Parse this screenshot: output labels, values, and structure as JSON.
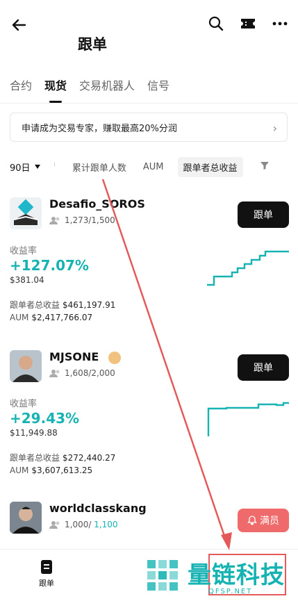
{
  "header": {
    "title": "跟单"
  },
  "tabs": [
    {
      "label": "合约"
    },
    {
      "label": "现货"
    },
    {
      "label": "交易机器人"
    },
    {
      "label": "信号"
    }
  ],
  "banner": {
    "text": "申请成为交易专家，赚取最高20%分润"
  },
  "filters": {
    "period": "90日",
    "followers": "累计跟单人数",
    "aum": "AUM",
    "active": "跟单者总收益"
  },
  "traders": [
    {
      "name": "Desafio_SOROS",
      "followers_current": "1,273",
      "followers_max": "/1,500",
      "button": "跟单",
      "roi_label": "收益率",
      "roi": "+127.07%",
      "pnl": "$381.04",
      "total_label": "跟单者总收益",
      "total": "$461,197.91",
      "aum_label": "AUM",
      "aum": "$2,417,766.07"
    },
    {
      "name": "MJSONE",
      "followers_current": "1,608",
      "followers_max": "/2,000",
      "button": "跟单",
      "roi_label": "收益率",
      "roi": "+29.43%",
      "pnl": "$11,949.88",
      "total_label": "跟单者总收益",
      "total": "$272,440.27",
      "aum_label": "AUM",
      "aum": "$3,607,613.25"
    },
    {
      "name": "worldclasskang",
      "followers_current": "1,000",
      "followers_sep": "/ ",
      "followers_max": "1,100",
      "button": "满员"
    }
  ],
  "bottom_nav": [
    {
      "label": "跟单"
    }
  ],
  "watermark": {
    "text": "量链科技",
    "sub": "QFSP.NET"
  },
  "colors": {
    "accent": "#17b3b3",
    "full": "#ef6a6a",
    "annotation": "#e45a5a"
  }
}
